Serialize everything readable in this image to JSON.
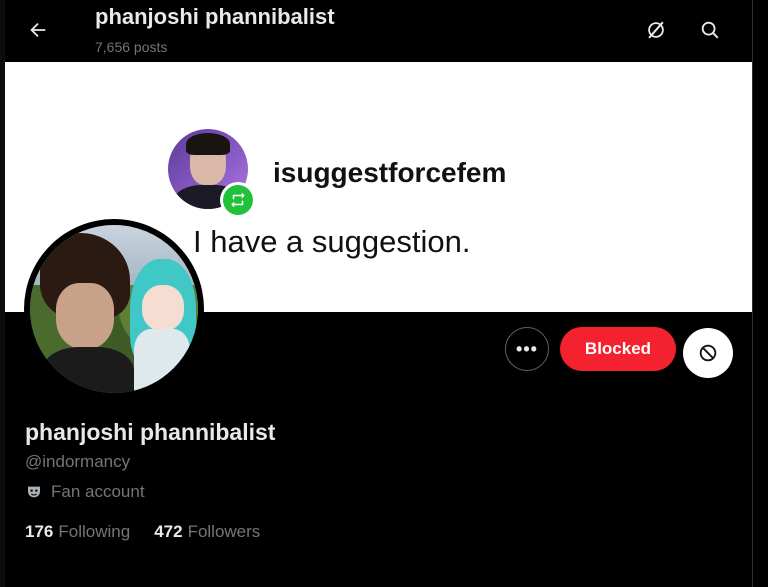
{
  "header": {
    "title": "phanjoshi phannibalist",
    "post_count": "7,656 posts"
  },
  "banner": {
    "username": "isuggestforcefem",
    "text": "I have a suggestion."
  },
  "actions": {
    "more_label": "•••",
    "blocked_label": "Blocked"
  },
  "profile": {
    "display_name": "phanjoshi phannibalist",
    "handle": "@indormancy",
    "category": "Fan account",
    "following_count": "176",
    "following_label": "Following",
    "followers_count": "472",
    "followers_label": "Followers"
  },
  "colors": {
    "background": "#000000",
    "blocked_red": "#f4212e",
    "muted_text": "#71767b",
    "repost_green": "#21c23a"
  },
  "icons": [
    "back-arrow-icon",
    "grok-icon",
    "search-icon",
    "repost-icon",
    "block-icon",
    "mask-icon"
  ]
}
